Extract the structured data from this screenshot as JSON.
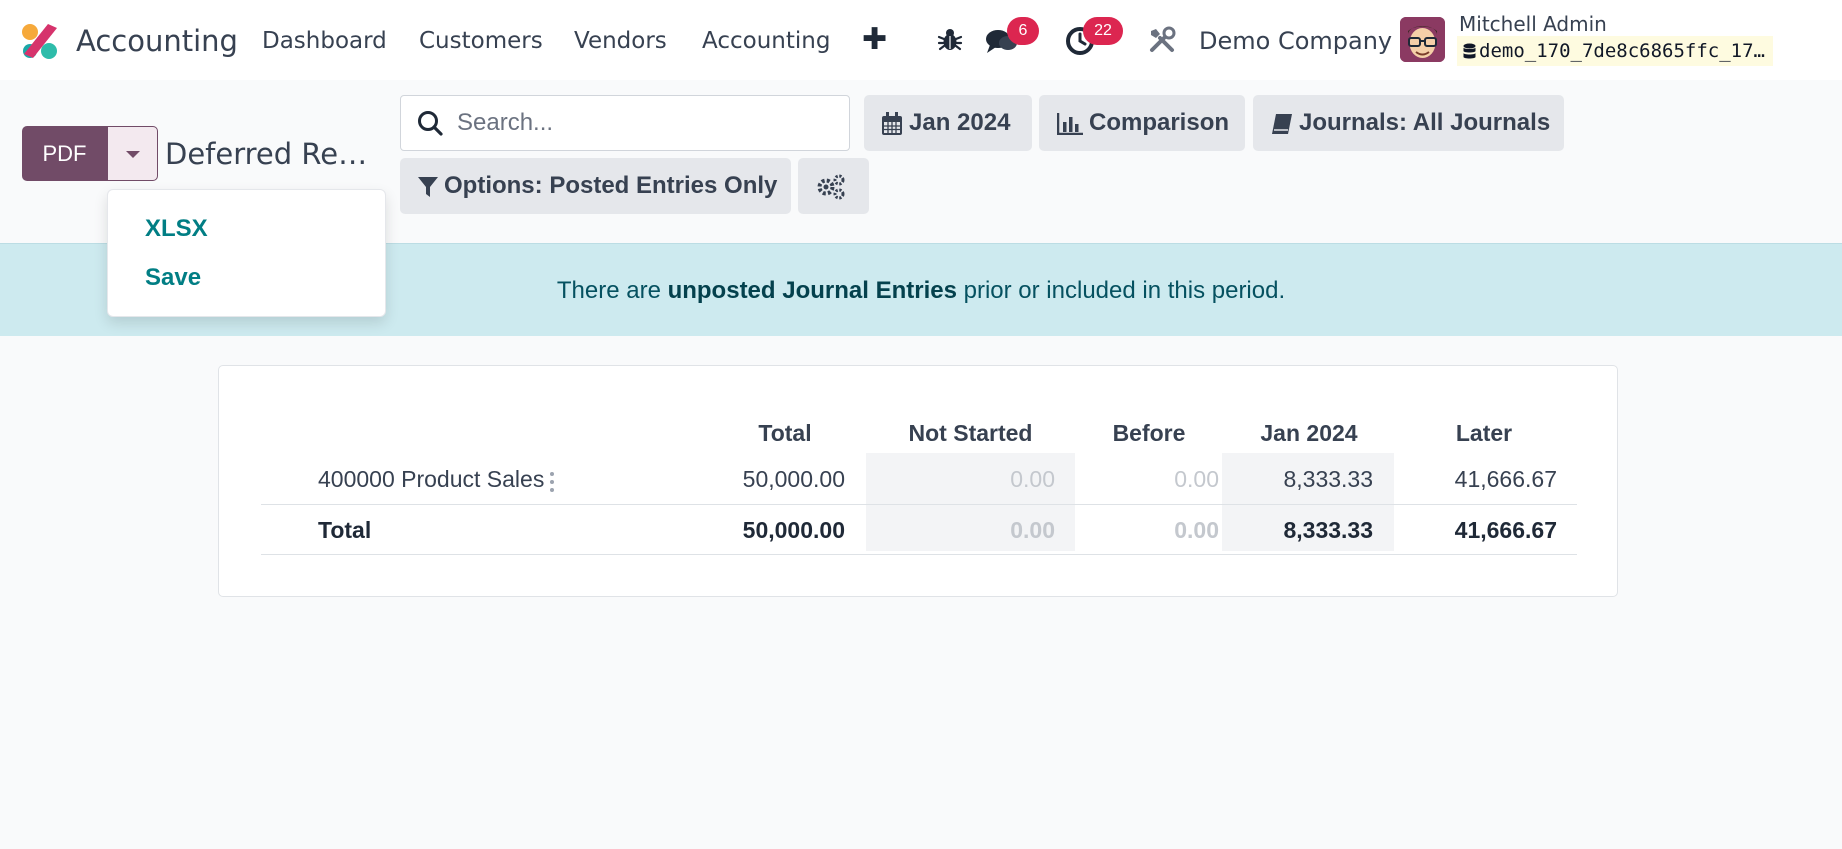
{
  "navbar": {
    "app_name": "Accounting",
    "menu": [
      "Dashboard",
      "Customers",
      "Vendors",
      "Accounting"
    ],
    "messages_count": "6",
    "activities_count": "22",
    "company": "Demo Company",
    "user_name": "Mitchell Admin",
    "database": "demo_170_7de8c6865ffc_17…"
  },
  "control_panel": {
    "pdf_label": "PDF",
    "report_title": "Deferred Re…",
    "search_placeholder": "Search...",
    "date_filter": "Jan 2024",
    "comparison_filter": "Comparison",
    "journals_filter": "Journals: All Journals",
    "options_filter": "Options: Posted Entries Only"
  },
  "dropdown": {
    "items": [
      "XLSX",
      "Save"
    ]
  },
  "alert": {
    "before": "There are ",
    "link": "unposted Journal Entries",
    "after": " prior or included in this period."
  },
  "report": {
    "columns": [
      "Total",
      "Not Started",
      "Before",
      "Jan 2024",
      "Later"
    ],
    "rows": [
      {
        "label": "400000 Product Sales",
        "values": [
          "50,000.00",
          "0.00",
          "0.00",
          "8,333.33",
          "41,666.67"
        ]
      }
    ],
    "total": {
      "label": "Total",
      "values": [
        "50,000.00",
        "0.00",
        "0.00",
        "8,333.33",
        "41,666.67"
      ]
    }
  },
  "colors": {
    "brand": "#714b67",
    "link_teal": "#017e84",
    "badge": "#dc2650",
    "alert_bg": "#cdeaef"
  },
  "icons": [
    "app-logo-icon",
    "plus-icon",
    "bug-icon",
    "chat-icon",
    "clock-icon",
    "tools-icon",
    "search-icon",
    "calendar-icon",
    "bar-chart-icon",
    "book-icon",
    "filter-icon",
    "cogs-icon",
    "database-icon",
    "kebab-icon"
  ]
}
